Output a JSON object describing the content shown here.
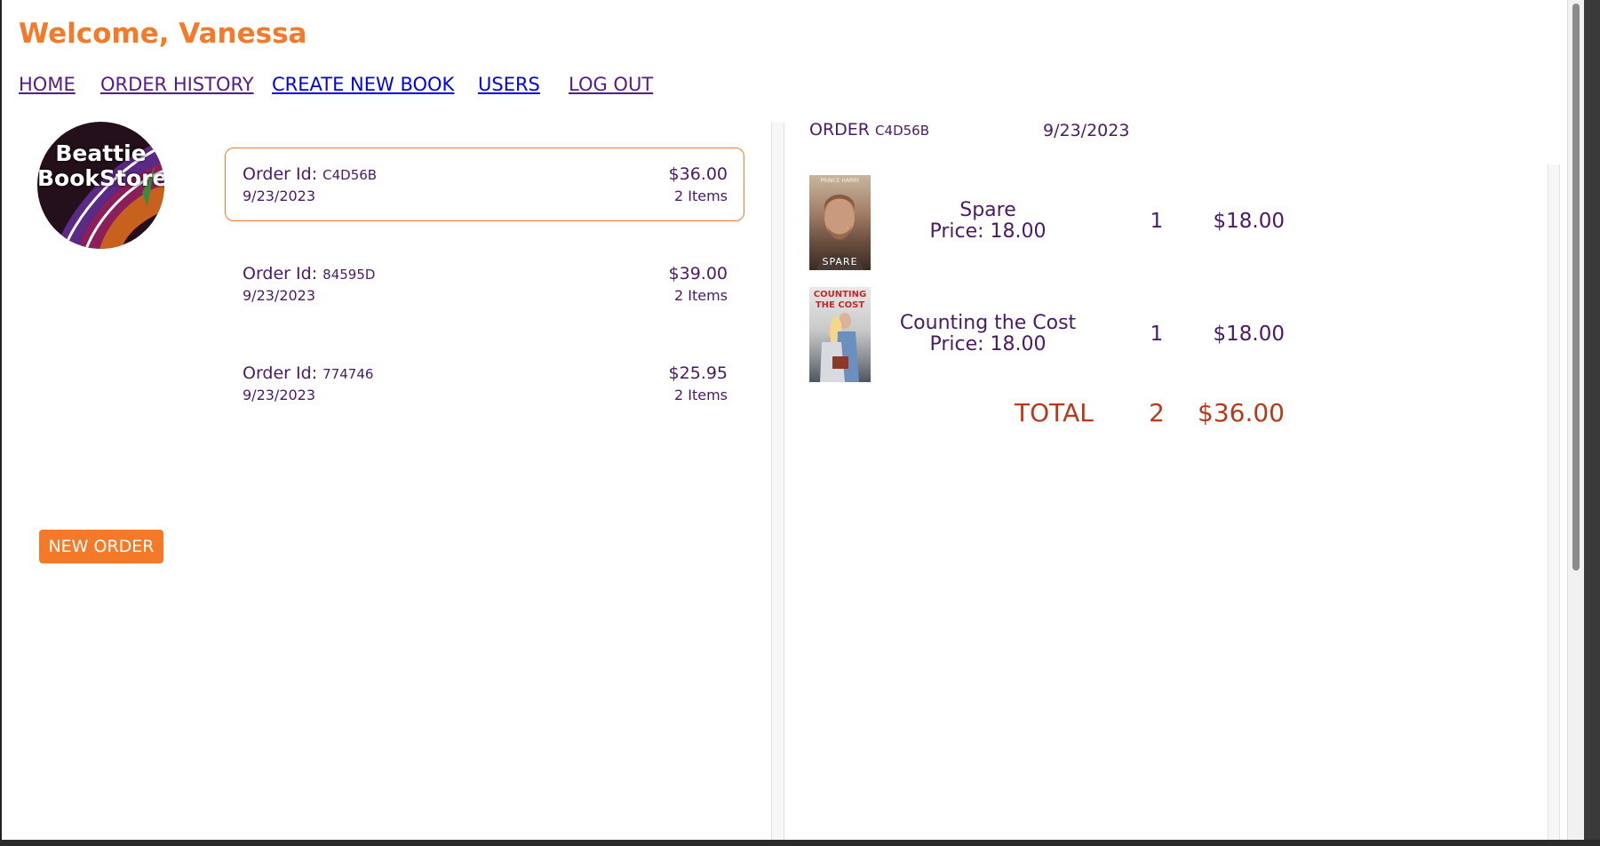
{
  "header": {
    "welcome": "Welcome, Vanessa"
  },
  "nav": {
    "home": "HOME",
    "order_history": "ORDER HISTORY",
    "create_new_book": "CREATE NEW BOOK",
    "users": "USERS",
    "log_out": "LOG OUT"
  },
  "logo": {
    "line1": "Beattie",
    "line2": "BookStore"
  },
  "new_order_label": "NEW ORDER",
  "orders": [
    {
      "id_label": "Order Id:",
      "code": "C4D56B",
      "date": "9/23/2023",
      "total": "$36.00",
      "items": "2 Items"
    },
    {
      "id_label": "Order Id:",
      "code": "84595D",
      "date": "9/23/2023",
      "total": "$39.00",
      "items": "2 Items"
    },
    {
      "id_label": "Order Id:",
      "code": "774746",
      "date": "9/23/2023",
      "total": "$25.95",
      "items": "2 Items"
    }
  ],
  "detail": {
    "label": "ORDER",
    "code": "C4D56B",
    "date": "9/23/2023",
    "lines": [
      {
        "title": "Spare",
        "price": "Price: 18.00",
        "qty": "1",
        "total": "$18.00",
        "cover_top": "PRINCE HARRY",
        "cover_title": "SPARE"
      },
      {
        "title": "Counting the Cost",
        "price": "Price: 18.00",
        "qty": "1",
        "total": "$18.00",
        "cover_top": "COUNTING THE COST"
      }
    ],
    "total_label": "TOTAL",
    "total_qty": "2",
    "total_amount": "$36.00"
  },
  "colors": {
    "accent": "#f47a2a",
    "text_purple": "#4a1a66",
    "total_red": "#b8391a"
  }
}
